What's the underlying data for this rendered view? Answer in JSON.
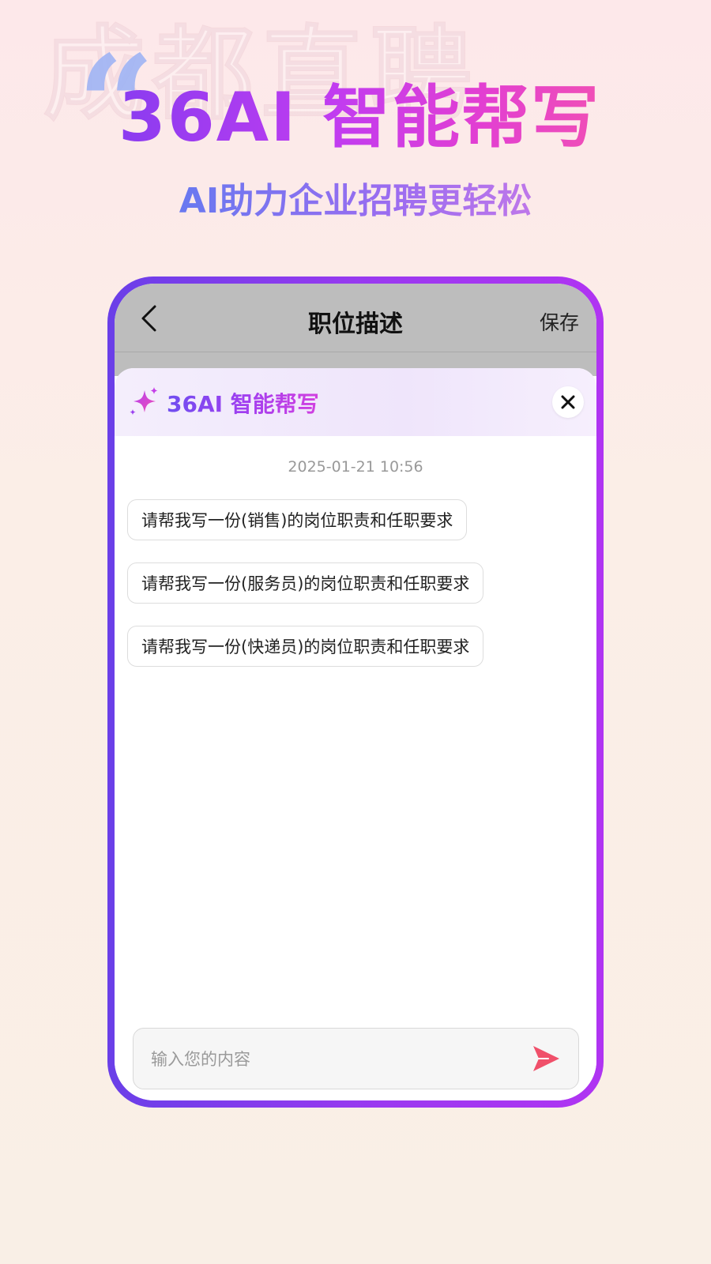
{
  "banner": {
    "watermark": "成都直聘",
    "quote_mark": "“",
    "headline": "36AI 智能帮写",
    "subheadline": "AI助力企业招聘更轻松"
  },
  "nav": {
    "title": "职位描述",
    "save_label": "保存",
    "back_icon": "chevron-left-icon"
  },
  "assistant": {
    "title": "36AI 智能帮写",
    "sparkle_icon": "sparkle-icon",
    "close_icon": "close-icon",
    "timestamp": "2025-01-21 10:56",
    "suggestions": [
      "请帮我写一份(销售)的岗位职责和任职要求",
      "请帮我写一份(服务员)的岗位职责和任职要求",
      "请帮我写一份(快递员)的岗位职责和任职要求"
    ]
  },
  "input": {
    "value": "",
    "placeholder": "输入您的内容",
    "send_icon": "send-icon"
  },
  "colors": {
    "accent_purple": "#9b39f0",
    "accent_pink": "#f04fb6",
    "send_red": "#f0506a"
  }
}
